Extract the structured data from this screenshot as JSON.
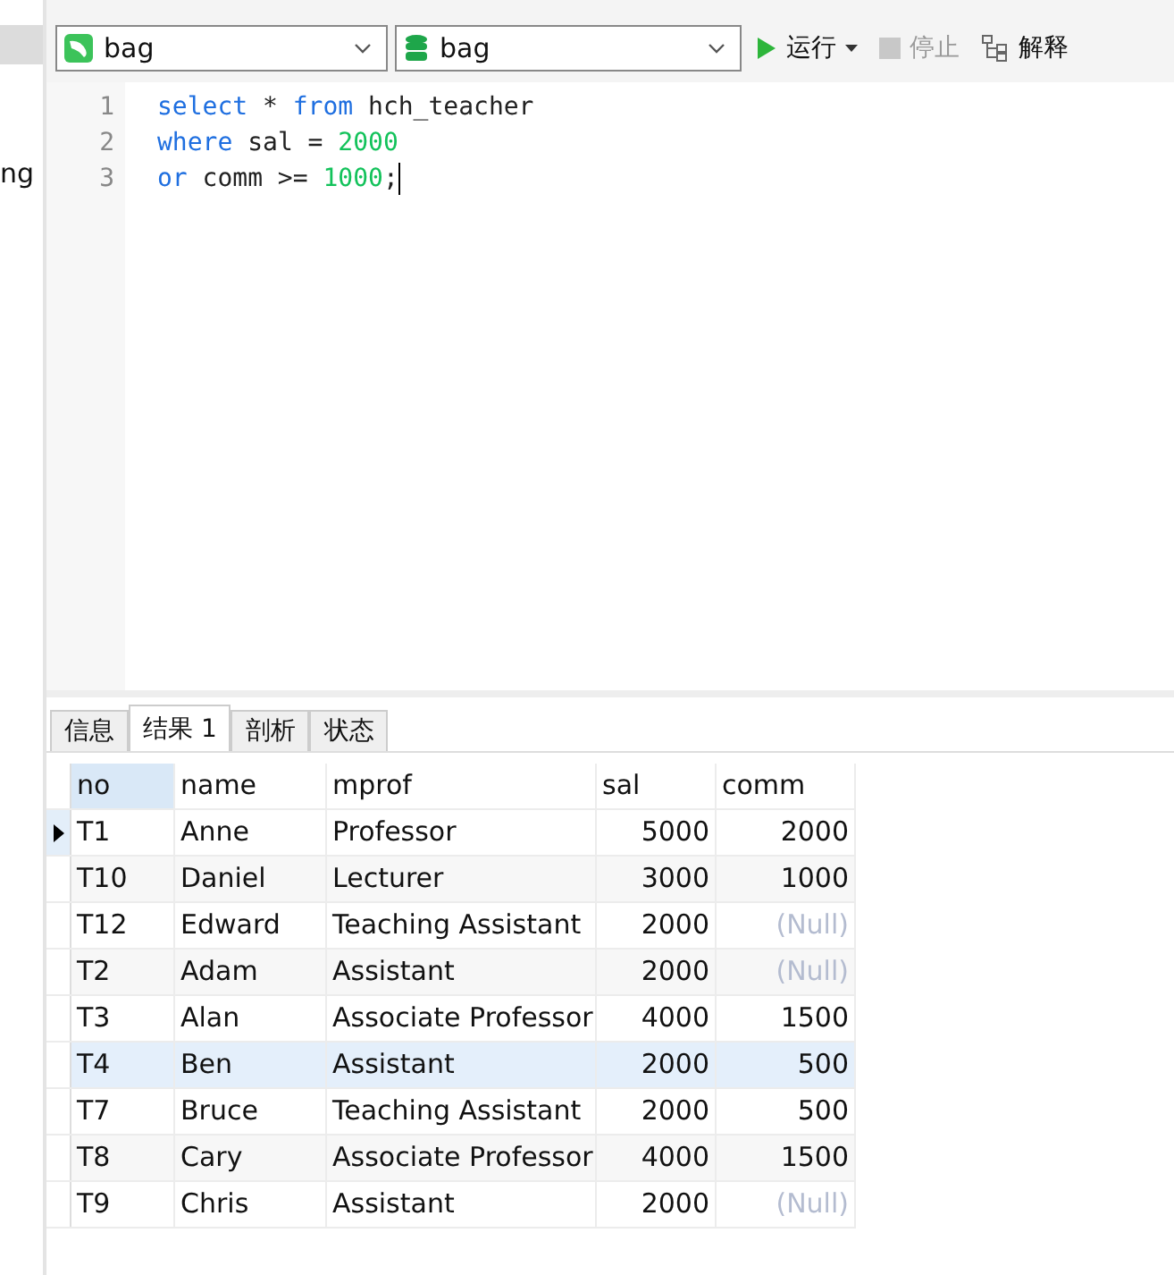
{
  "sidebar": {
    "items": [
      {
        "label": "ng",
        "selected": false
      }
    ]
  },
  "toolbar": {
    "connection": {
      "value": "bag"
    },
    "database": {
      "value": "bag"
    },
    "buttons": [
      {
        "kind": "run",
        "label": "运行",
        "disabled": false
      },
      {
        "kind": "stop",
        "label": "停止",
        "disabled": true
      },
      {
        "kind": "explain",
        "label": "解释",
        "disabled": false
      }
    ]
  },
  "editor": {
    "lines": [
      {
        "number": "1",
        "tokens": [
          {
            "kind": "keyword",
            "text": "select"
          },
          {
            "kind": "plain",
            "text": " * "
          },
          {
            "kind": "keyword",
            "text": "from"
          },
          {
            "kind": "plain",
            "text": " hch_teacher"
          }
        ]
      },
      {
        "number": "2",
        "tokens": [
          {
            "kind": "keyword",
            "text": "where"
          },
          {
            "kind": "plain",
            "text": " sal = "
          },
          {
            "kind": "number",
            "text": "2000"
          }
        ]
      },
      {
        "number": "3",
        "tokens": [
          {
            "kind": "keyword",
            "text": "or"
          },
          {
            "kind": "plain",
            "text": " comm >= "
          },
          {
            "kind": "number",
            "text": "1000"
          },
          {
            "kind": "plain",
            "text": ";"
          }
        ]
      }
    ]
  },
  "tabs": [
    {
      "label": "信息",
      "selected": false
    },
    {
      "label": "结果 1",
      "selected": true
    },
    {
      "label": "剖析",
      "selected": false
    },
    {
      "label": "状态",
      "selected": false
    }
  ],
  "table": {
    "columns": [
      {
        "label": "no",
        "selected": true
      },
      {
        "label": "name",
        "selected": false
      },
      {
        "label": "mprof",
        "selected": false
      },
      {
        "label": "sal",
        "selected": false
      },
      {
        "label": "comm",
        "selected": false
      }
    ],
    "rows": [
      {
        "selected": true,
        "hovered": false,
        "cells": [
          {
            "text": "T1",
            "null": false
          },
          {
            "text": "Anne",
            "null": false
          },
          {
            "text": "Professor",
            "null": false
          },
          {
            "text": "5000",
            "null": false
          },
          {
            "text": "2000",
            "null": false
          }
        ]
      },
      {
        "selected": false,
        "hovered": false,
        "cells": [
          {
            "text": "T10",
            "null": false
          },
          {
            "text": "Daniel",
            "null": false
          },
          {
            "text": "Lecturer",
            "null": false
          },
          {
            "text": "3000",
            "null": false
          },
          {
            "text": "1000",
            "null": false
          }
        ]
      },
      {
        "selected": false,
        "hovered": false,
        "cells": [
          {
            "text": "T12",
            "null": false
          },
          {
            "text": "Edward",
            "null": false
          },
          {
            "text": "Teaching Assistant",
            "null": false
          },
          {
            "text": "2000",
            "null": false
          },
          {
            "text": "(Null)",
            "null": true
          }
        ]
      },
      {
        "selected": false,
        "hovered": false,
        "cells": [
          {
            "text": "T2",
            "null": false
          },
          {
            "text": "Adam",
            "null": false
          },
          {
            "text": "Assistant",
            "null": false
          },
          {
            "text": "2000",
            "null": false
          },
          {
            "text": "(Null)",
            "null": true
          }
        ]
      },
      {
        "selected": false,
        "hovered": false,
        "cells": [
          {
            "text": "T3",
            "null": false
          },
          {
            "text": "Alan",
            "null": false
          },
          {
            "text": "Associate Professor",
            "null": false
          },
          {
            "text": "4000",
            "null": false
          },
          {
            "text": "1500",
            "null": false
          }
        ]
      },
      {
        "selected": false,
        "hovered": true,
        "cells": [
          {
            "text": "T4",
            "null": false
          },
          {
            "text": "Ben",
            "null": false
          },
          {
            "text": "Assistant",
            "null": false
          },
          {
            "text": "2000",
            "null": false
          },
          {
            "text": "500",
            "null": false
          }
        ]
      },
      {
        "selected": false,
        "hovered": false,
        "cells": [
          {
            "text": "T7",
            "null": false
          },
          {
            "text": "Bruce",
            "null": false
          },
          {
            "text": "Teaching Assistant",
            "null": false
          },
          {
            "text": "2000",
            "null": false
          },
          {
            "text": "500",
            "null": false
          }
        ]
      },
      {
        "selected": false,
        "hovered": false,
        "cells": [
          {
            "text": "T8",
            "null": false
          },
          {
            "text": "Cary",
            "null": false
          },
          {
            "text": "Associate Professor",
            "null": false
          },
          {
            "text": "4000",
            "null": false
          },
          {
            "text": "1500",
            "null": false
          }
        ]
      },
      {
        "selected": false,
        "hovered": false,
        "cells": [
          {
            "text": "T9",
            "null": false
          },
          {
            "text": "Chris",
            "null": false
          },
          {
            "text": "Assistant",
            "null": false
          },
          {
            "text": "2000",
            "null": false
          },
          {
            "text": "(Null)",
            "null": true
          }
        ]
      }
    ]
  }
}
